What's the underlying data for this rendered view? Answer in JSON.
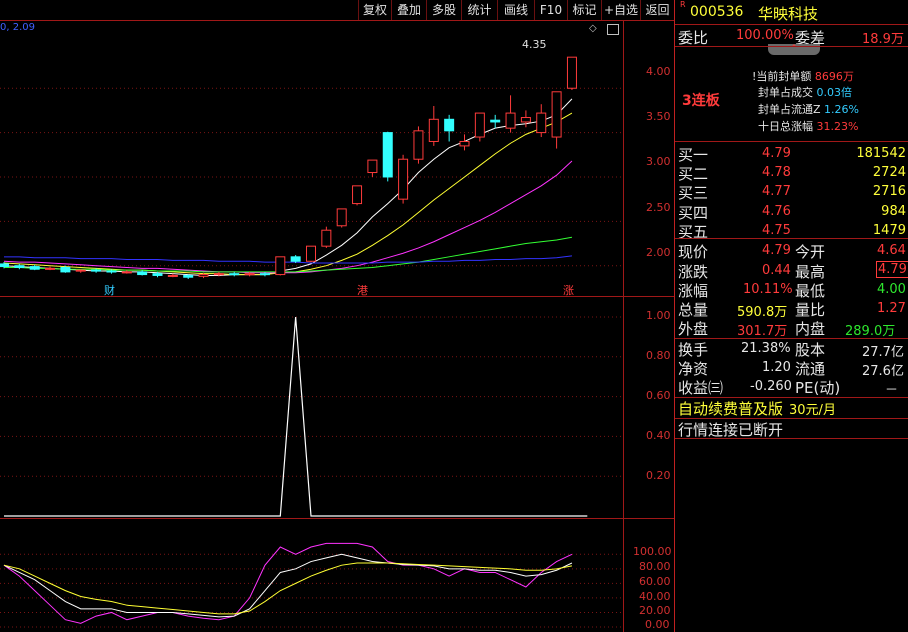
{
  "toolbar": {
    "items": [
      "复权",
      "叠加",
      "多股",
      "统计",
      "画线",
      "F10",
      "标记",
      "+自选",
      "返回"
    ]
  },
  "stock": {
    "r_badge": "R",
    "code": "000536",
    "name": "华映科技"
  },
  "weibi": {
    "label": "委比",
    "value": "100.00%",
    "diff_label": "委差",
    "diff_value": "18.9万"
  },
  "board": {
    "streak": "3连板",
    "lines": [
      {
        "label": "!当前封单额",
        "value": "8696万"
      },
      {
        "label": "封单占成交",
        "value": "0.03倍"
      },
      {
        "label": "封单占流通Z",
        "value": "1.26%"
      },
      {
        "label": "十日总涨幅",
        "value": "31.23%"
      }
    ]
  },
  "bids": [
    {
      "label": "买一",
      "price": "4.79",
      "vol": "181542"
    },
    {
      "label": "买二",
      "price": "4.78",
      "vol": "2724"
    },
    {
      "label": "买三",
      "price": "4.77",
      "vol": "2716"
    },
    {
      "label": "买四",
      "price": "4.76",
      "vol": "984"
    },
    {
      "label": "买五",
      "price": "4.75",
      "vol": "1479"
    }
  ],
  "quote": {
    "xianjia_l": "现价",
    "xianjia": "4.79",
    "jinkai_l": "今开",
    "jinkai": "4.64",
    "zhangdie_l": "涨跌",
    "zhangdie": "0.44",
    "zuigao_l": "最高",
    "zuigao": "4.79",
    "zhangfu_l": "涨幅",
    "zhangfu": "10.11%",
    "zuidi_l": "最低",
    "zuidi": "4.00",
    "zongliang_l": "总量",
    "zongliang": "590.8万",
    "liangbi_l": "量比",
    "liangbi": "1.27",
    "waipan_l": "外盘",
    "waipan": "301.7万",
    "neipan_l": "内盘",
    "neipan": "289.0万"
  },
  "fund": {
    "huanshou_l": "换手",
    "huanshou": "21.38%",
    "guben_l": "股本",
    "guben": "27.7亿",
    "jingzi_l": "净资",
    "jingzi": "1.20",
    "liutong_l": "流通",
    "liutong": "27.6亿",
    "shouyi_l": "收益㈢",
    "shouyi": "-0.260",
    "pe_l": "PE(动)",
    "pe": "－"
  },
  "promo": {
    "text": "自动续费普及版",
    "price": "30元/月"
  },
  "status": {
    "text": "行情连接已断开"
  },
  "chart": {
    "ma_label": "0, 2.09",
    "peak_label": "4.35",
    "price_axis": [
      "4.00",
      "3.50",
      "3.00",
      "2.50",
      "2.00"
    ],
    "ind1_axis": [
      "1.00",
      "0.80",
      "0.60",
      "0.40",
      "0.20"
    ],
    "ind2_axis": [
      "100.00",
      "80.00",
      "60.00",
      "40.00",
      "20.00",
      "0.00"
    ],
    "markers": [
      {
        "text": "财",
        "color": "#33ccff"
      },
      {
        "text": "港",
        "color": "#ff3b3b"
      },
      {
        "text": "涨",
        "color": "#ff3b3b"
      }
    ],
    "colors": {
      "up": "#ff3b3b",
      "down": "#33ffff",
      "grid": "#a01818"
    }
  },
  "chart_data": {
    "type": "candlestick",
    "ylim": [
      1.85,
      4.6
    ],
    "candles": [
      {
        "o": 2.02,
        "c": 1.99,
        "h": 2.04,
        "l": 1.97
      },
      {
        "o": 2.0,
        "c": 1.98,
        "h": 2.02,
        "l": 1.96
      },
      {
        "o": 1.99,
        "c": 1.96,
        "h": 2.01,
        "l": 1.95
      },
      {
        "o": 1.97,
        "c": 1.97,
        "h": 1.99,
        "l": 1.95
      },
      {
        "o": 1.98,
        "c": 1.93,
        "h": 2.0,
        "l": 1.92
      },
      {
        "o": 1.94,
        "c": 1.95,
        "h": 1.96,
        "l": 1.92
      },
      {
        "o": 1.95,
        "c": 1.94,
        "h": 1.97,
        "l": 1.92
      },
      {
        "o": 1.94,
        "c": 1.93,
        "h": 1.96,
        "l": 1.91
      },
      {
        "o": 1.93,
        "c": 1.93,
        "h": 1.95,
        "l": 1.91
      },
      {
        "o": 1.93,
        "c": 1.9,
        "h": 1.95,
        "l": 1.89
      },
      {
        "o": 1.91,
        "c": 1.89,
        "h": 1.93,
        "l": 1.87
      },
      {
        "o": 1.89,
        "c": 1.89,
        "h": 1.91,
        "l": 1.87
      },
      {
        "o": 1.89,
        "c": 1.87,
        "h": 1.9,
        "l": 1.85
      },
      {
        "o": 1.88,
        "c": 1.9,
        "h": 1.92,
        "l": 1.86
      },
      {
        "o": 1.9,
        "c": 1.91,
        "h": 1.93,
        "l": 1.88
      },
      {
        "o": 1.91,
        "c": 1.9,
        "h": 1.93,
        "l": 1.88
      },
      {
        "o": 1.9,
        "c": 1.91,
        "h": 1.93,
        "l": 1.88
      },
      {
        "o": 1.91,
        "c": 1.9,
        "h": 1.93,
        "l": 1.88
      },
      {
        "o": 1.9,
        "c": 2.1,
        "h": 2.1,
        "l": 1.89
      },
      {
        "o": 2.1,
        "c": 2.05,
        "h": 2.12,
        "l": 2.03
      },
      {
        "o": 2.05,
        "c": 2.22,
        "h": 2.22,
        "l": 2.04
      },
      {
        "o": 2.22,
        "c": 2.4,
        "h": 2.44,
        "l": 2.2
      },
      {
        "o": 2.45,
        "c": 2.64,
        "h": 2.64,
        "l": 2.43
      },
      {
        "o": 2.7,
        "c": 2.9,
        "h": 2.9,
        "l": 2.68
      },
      {
        "o": 3.05,
        "c": 3.19,
        "h": 3.19,
        "l": 3.0
      },
      {
        "o": 3.5,
        "c": 3.0,
        "h": 3.51,
        "l": 2.95
      },
      {
        "o": 2.75,
        "c": 3.2,
        "h": 3.25,
        "l": 2.7
      },
      {
        "o": 3.2,
        "c": 3.52,
        "h": 3.57,
        "l": 3.15
      },
      {
        "o": 3.4,
        "c": 3.65,
        "h": 3.8,
        "l": 3.35
      },
      {
        "o": 3.65,
        "c": 3.52,
        "h": 3.7,
        "l": 3.4
      },
      {
        "o": 3.35,
        "c": 3.4,
        "h": 3.48,
        "l": 3.3
      },
      {
        "o": 3.45,
        "c": 3.72,
        "h": 3.72,
        "l": 3.4
      },
      {
        "o": 3.64,
        "c": 3.62,
        "h": 3.7,
        "l": 3.55
      },
      {
        "o": 3.55,
        "c": 3.72,
        "h": 3.92,
        "l": 3.5
      },
      {
        "o": 3.62,
        "c": 3.67,
        "h": 3.75,
        "l": 3.56
      },
      {
        "o": 3.5,
        "c": 3.72,
        "h": 3.82,
        "l": 3.45
      },
      {
        "o": 3.45,
        "c": 3.96,
        "h": 3.96,
        "l": 3.32
      },
      {
        "o": 4.0,
        "c": 4.35,
        "h": 4.35,
        "l": 3.98
      }
    ],
    "ma": [
      {
        "color": "#ffffff",
        "values": [
          2.0,
          1.99,
          1.98,
          1.97,
          1.96,
          1.95,
          1.94,
          1.94,
          1.93,
          1.93,
          1.92,
          1.91,
          1.9,
          1.89,
          1.89,
          1.9,
          1.9,
          1.9,
          1.94,
          1.97,
          2.02,
          2.12,
          2.23,
          2.37,
          2.55,
          2.7,
          2.86,
          3.05,
          3.2,
          3.33,
          3.4,
          3.48,
          3.55,
          3.58,
          3.6,
          3.63,
          3.7,
          3.88
        ]
      },
      {
        "color": "#ffff33",
        "values": [
          2.03,
          2.02,
          2.01,
          2.0,
          1.99,
          1.98,
          1.97,
          1.96,
          1.95,
          1.95,
          1.94,
          1.93,
          1.92,
          1.91,
          1.91,
          1.9,
          1.9,
          1.9,
          1.92,
          1.93,
          1.96,
          2.0,
          2.06,
          2.13,
          2.23,
          2.34,
          2.46,
          2.6,
          2.74,
          2.87,
          3.0,
          3.13,
          3.26,
          3.38,
          3.48,
          3.55,
          3.62,
          3.72
        ]
      },
      {
        "color": "#ff33ff",
        "values": [
          2.05,
          2.04,
          2.04,
          2.03,
          2.02,
          2.01,
          2.0,
          1.99,
          1.98,
          1.97,
          1.97,
          1.96,
          1.95,
          1.94,
          1.93,
          1.93,
          1.92,
          1.92,
          1.92,
          1.92,
          1.93,
          1.95,
          1.97,
          2.0,
          2.04,
          2.09,
          2.14,
          2.2,
          2.27,
          2.35,
          2.43,
          2.51,
          2.6,
          2.7,
          2.8,
          2.9,
          3.02,
          3.18
        ]
      },
      {
        "color": "#33ff33",
        "values": [
          1.98,
          1.98,
          1.97,
          1.97,
          1.96,
          1.96,
          1.96,
          1.95,
          1.95,
          1.95,
          1.94,
          1.94,
          1.94,
          1.93,
          1.93,
          1.93,
          1.93,
          1.93,
          1.93,
          1.93,
          1.94,
          1.95,
          1.96,
          1.97,
          1.98,
          2.0,
          2.02,
          2.04,
          2.07,
          2.1,
          2.13,
          2.16,
          2.19,
          2.22,
          2.25,
          2.27,
          2.29,
          2.32
        ]
      },
      {
        "color": "#3333ff",
        "values": [
          2.1,
          2.1,
          2.09,
          2.09,
          2.09,
          2.08,
          2.08,
          2.08,
          2.07,
          2.07,
          2.07,
          2.06,
          2.06,
          2.06,
          2.05,
          2.05,
          2.05,
          2.04,
          2.04,
          2.04,
          2.03,
          2.03,
          2.03,
          2.03,
          2.03,
          2.04,
          2.04,
          2.04,
          2.05,
          2.05,
          2.06,
          2.06,
          2.07,
          2.07,
          2.08,
          2.08,
          2.09,
          2.11
        ]
      }
    ],
    "indicator1": {
      "ylim": [
        0,
        1
      ],
      "values": [
        0,
        0,
        0,
        0,
        0,
        0,
        0,
        0,
        0,
        0,
        0,
        0,
        0,
        0,
        0,
        0,
        0,
        0,
        0,
        1,
        0,
        0,
        0,
        0,
        0,
        0,
        0,
        0,
        0,
        0,
        0,
        0,
        0,
        0,
        0,
        0,
        0,
        0,
        0
      ]
    },
    "indicator2": {
      "ylim": [
        0,
        110
      ],
      "series": [
        {
          "color": "#ff33ff",
          "values": [
            85,
            70,
            50,
            30,
            10,
            5,
            15,
            20,
            10,
            15,
            20,
            20,
            15,
            12,
            10,
            15,
            40,
            85,
            110,
            100,
            110,
            115,
            115,
            115,
            110,
            90,
            85,
            85,
            80,
            70,
            80,
            75,
            75,
            65,
            55,
            75,
            90,
            100
          ]
        },
        {
          "color": "#ffffff",
          "values": [
            85,
            75,
            65,
            50,
            35,
            25,
            25,
            25,
            20,
            20,
            20,
            20,
            18,
            16,
            14,
            15,
            25,
            50,
            75,
            80,
            90,
            95,
            100,
            95,
            90,
            88,
            86,
            85,
            84,
            80,
            80,
            78,
            78,
            75,
            70,
            72,
            78,
            88
          ]
        },
        {
          "color": "#ffff33",
          "values": [
            85,
            80,
            70,
            60,
            50,
            42,
            38,
            35,
            30,
            28,
            26,
            24,
            22,
            20,
            18,
            18,
            22,
            35,
            50,
            60,
            70,
            78,
            85,
            88,
            88,
            88,
            87,
            86,
            85,
            84,
            83,
            82,
            81,
            80,
            78,
            78,
            80,
            84
          ]
        }
      ]
    }
  }
}
